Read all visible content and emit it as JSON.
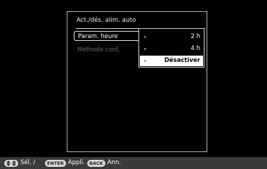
{
  "dialog": {
    "title": "Act./dés. alim. auto",
    "menu": [
      {
        "label": "Param. heure"
      },
      {
        "label": "Méthode conf."
      }
    ]
  },
  "submenu": {
    "options": [
      {
        "label": "2 h"
      },
      {
        "label": "4 h"
      },
      {
        "label": "Désactiver"
      }
    ],
    "selected_index": 2
  },
  "bottom_bar": {
    "select_icon": "up-down-arrows-icon",
    "select_label": "Sél. /",
    "enter_badge": "ENTER",
    "enter_label": "Appli.",
    "back_badge": "BACK",
    "back_label": "Ann."
  },
  "colors": {
    "background": "#000000",
    "bar": "#3a3a3a",
    "highlight": "#ffffff"
  }
}
